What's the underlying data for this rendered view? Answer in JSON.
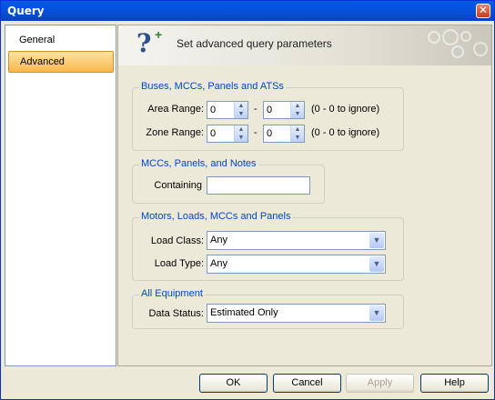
{
  "window": {
    "title": "Query",
    "close_symbol": "✕"
  },
  "sidebar": {
    "items": [
      {
        "label": "General",
        "active": false
      },
      {
        "label": "Advanced",
        "active": true
      }
    ]
  },
  "header": {
    "title": "Set advanced query parameters",
    "icon": "question-plus-icon"
  },
  "groups": {
    "buses": {
      "legend": "Buses, MCCs, Panels and ATSs",
      "area_label": "Area Range:",
      "area_from": "0",
      "area_to": "0",
      "area_note": "(0 - 0 to ignore)",
      "zone_label": "Zone Range:",
      "zone_from": "0",
      "zone_to": "0",
      "zone_note": "(0 - 0 to ignore)",
      "dash": "-"
    },
    "notes": {
      "legend": "MCCs, Panels, and Notes",
      "containing_label": "Containing",
      "containing_value": ""
    },
    "motors": {
      "legend": "Motors, Loads, MCCs and Panels",
      "load_class_label": "Load Class:",
      "load_class_value": "Any",
      "load_type_label": "Load Type:",
      "load_type_value": "Any"
    },
    "equipment": {
      "legend": "All Equipment",
      "data_status_label": "Data Status:",
      "data_status_value": "Estimated Only"
    }
  },
  "buttons": {
    "ok": "OK",
    "cancel": "Cancel",
    "apply": "Apply",
    "help": "Help"
  }
}
